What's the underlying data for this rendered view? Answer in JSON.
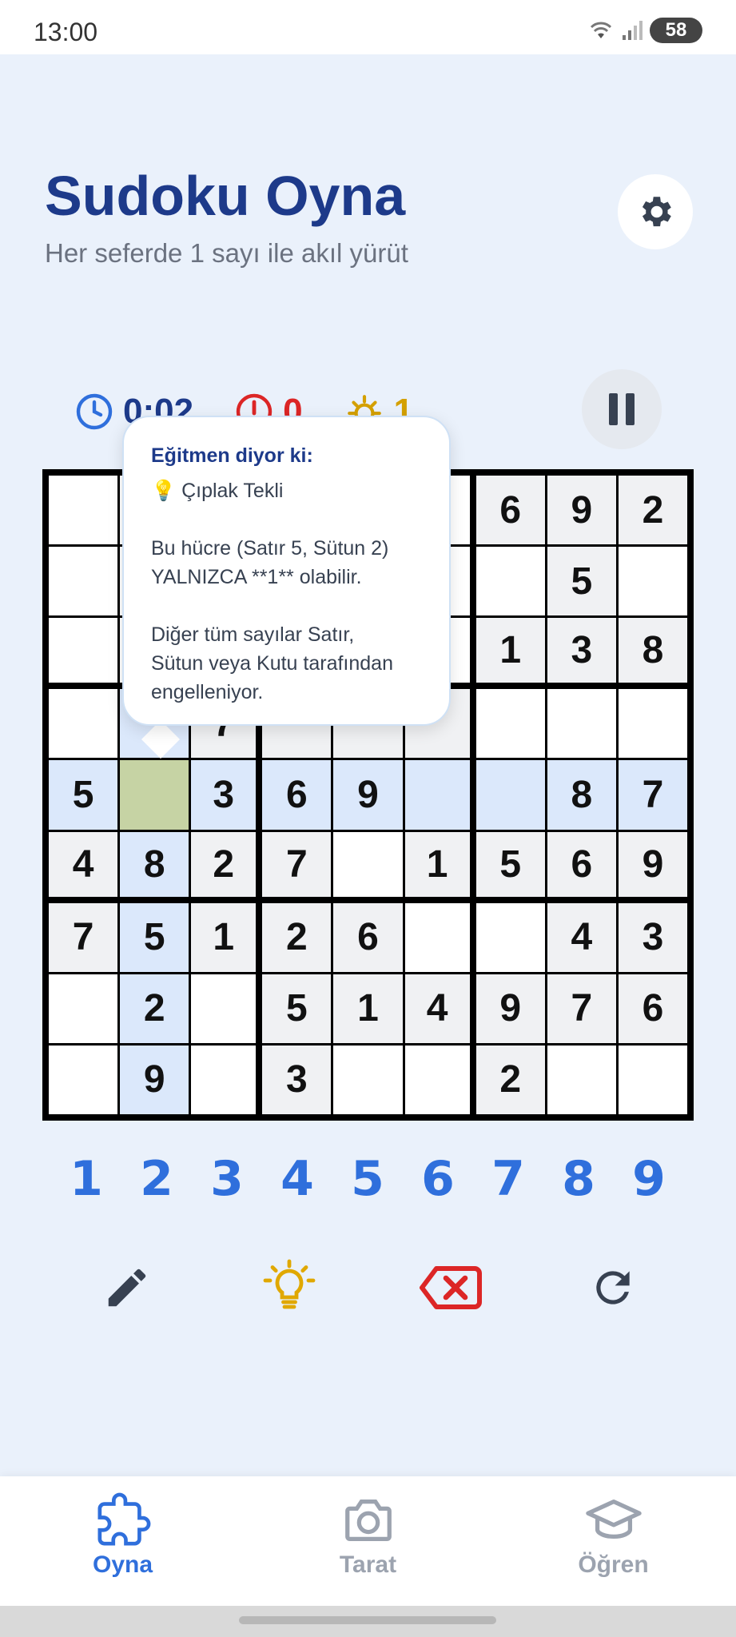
{
  "status": {
    "time": "13:00",
    "battery": "58"
  },
  "header": {
    "title": "Sudoku Oyna",
    "subtitle": "Her seferde 1 sayı ile akıl yürüt",
    "settings_icon": "gear-icon"
  },
  "stats": {
    "time": "0:02",
    "errors": "0",
    "hints": "1"
  },
  "tooltip": {
    "heading": "Eğitmen diyor ki:",
    "technique": "💡 Çıplak Tekli",
    "body1": "Bu hücre (Satır 5, Sütun 2)\nYALNIZCA **1** olabilir.",
    "body2": "Diğer tüm sayılar Satır,\nSütun veya Kutu tarafından\nengelleniyor."
  },
  "board": [
    [
      "",
      "",
      "",
      "",
      "",
      "",
      "6",
      "9",
      "2"
    ],
    [
      "",
      "",
      "",
      "",
      "",
      "",
      "",
      "5",
      ""
    ],
    [
      "",
      "",
      "",
      "",
      "",
      "",
      "1",
      "3",
      "8"
    ],
    [
      "",
      "",
      "7",
      "",
      "",
      "",
      "",
      "",
      ""
    ],
    [
      "5",
      "",
      "3",
      "6",
      "9",
      "",
      "",
      "8",
      "7"
    ],
    [
      "4",
      "8",
      "2",
      "7",
      "",
      "1",
      "5",
      "6",
      "9"
    ],
    [
      "7",
      "5",
      "1",
      "2",
      "6",
      "",
      "",
      "4",
      "3"
    ],
    [
      "",
      "2",
      "",
      "5",
      "1",
      "4",
      "9",
      "7",
      "6"
    ],
    [
      "",
      "9",
      "",
      "3",
      "",
      "",
      "2",
      "",
      ""
    ]
  ],
  "cell_styles": [
    [
      "w",
      "w",
      "g",
      "w",
      "w",
      "w",
      "g",
      "g",
      "g"
    ],
    [
      "w",
      "w",
      "w",
      "w",
      "w",
      "w",
      "w",
      "g",
      "w"
    ],
    [
      "w",
      "w",
      "w",
      "w",
      "w",
      "w",
      "g",
      "g",
      "g"
    ],
    [
      "w",
      "h",
      "g",
      "g",
      "g",
      "g",
      "w",
      "w",
      "w"
    ],
    [
      "h",
      "sel",
      "h",
      "h",
      "h",
      "h",
      "h",
      "h",
      "h"
    ],
    [
      "g",
      "h",
      "g",
      "g",
      "w",
      "g",
      "g",
      "g",
      "g"
    ],
    [
      "g",
      "h",
      "g",
      "g",
      "g",
      "w",
      "w",
      "g",
      "g"
    ],
    [
      "w",
      "h",
      "w",
      "g",
      "g",
      "g",
      "g",
      "g",
      "g"
    ],
    [
      "w",
      "h",
      "w",
      "g",
      "w",
      "w",
      "g",
      "w",
      "w"
    ]
  ],
  "number_pad": [
    "1",
    "2",
    "3",
    "4",
    "5",
    "6",
    "7",
    "8",
    "9"
  ],
  "actions": [
    {
      "name": "pencil-icon"
    },
    {
      "name": "lightbulb-icon"
    },
    {
      "name": "erase-icon"
    },
    {
      "name": "refresh-icon"
    }
  ],
  "nav": {
    "items": [
      {
        "label": "Oyna",
        "icon": "puzzle-icon",
        "active": true
      },
      {
        "label": "Tarat",
        "icon": "camera-icon",
        "active": false
      },
      {
        "label": "Öğren",
        "icon": "graduation-cap-icon",
        "active": false
      }
    ]
  },
  "colors": {
    "accent": "#2f6fdc",
    "title": "#1d3a8a",
    "error": "#dc2626",
    "hint": "#d4a000",
    "selected": "#c6d3a4",
    "highlight": "#dbe8fb"
  }
}
